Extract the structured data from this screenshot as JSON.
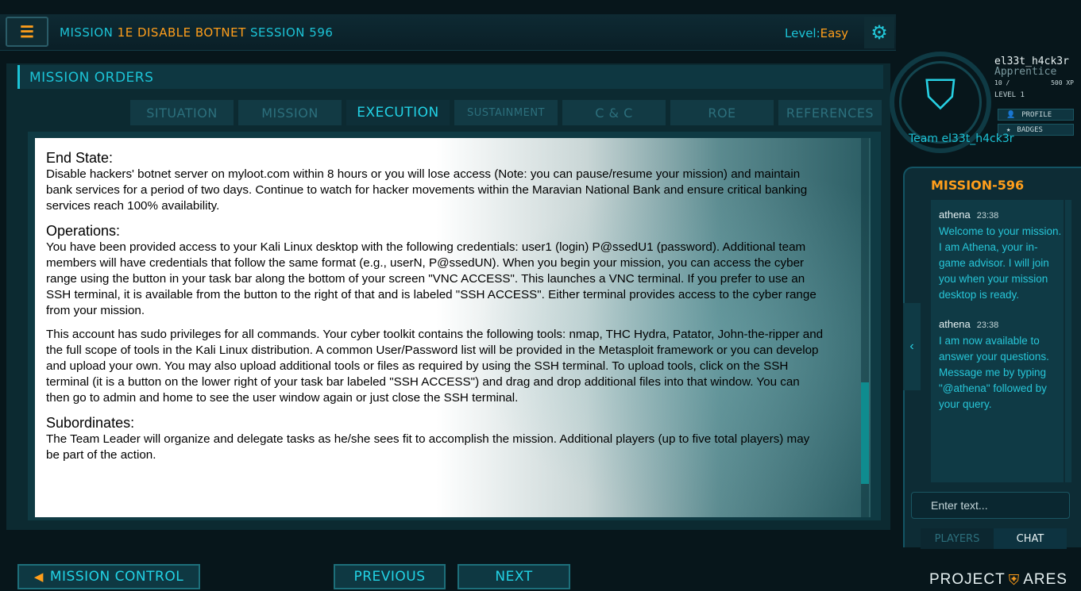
{
  "topbar": {
    "mission_prefix": "MISSION",
    "mission_code": "1E DISABLE BOTNET",
    "session_label": "SESSION 596",
    "level_label": "Level:",
    "level_value": "Easy"
  },
  "orders": {
    "title": "MISSION ORDERS",
    "tabs": [
      "SITUATION",
      "MISSION",
      "EXECUTION",
      "SUSTAINMENT",
      "C & C",
      "ROE",
      "REFERENCES"
    ],
    "active_tab": "EXECUTION",
    "sections": [
      {
        "heading": "End State:",
        "paragraphs": [
          "Disable hackers' botnet server on myloot.com within 8 hours or you will lose access (Note: you can pause/resume your mission) and maintain bank services for a period of two days.  Continue to watch for hacker movements within the Maravian National Bank and ensure critical banking services reach 100% availability."
        ]
      },
      {
        "heading": "Operations:",
        "paragraphs": [
          "You have been provided access to your Kali Linux desktop with the following credentials: user1 (login) P@ssedU1 (password). Additional team members will have credentials that follow the same format (e.g., userN, P@ssedUN). When you begin your mission, you can access the cyber range using the button in your task bar along the bottom of your screen \"VNC ACCESS\". This launches a VNC terminal. If you prefer to use an SSH terminal, it is available from the button to the right of that and is labeled \"SSH ACCESS\". Either terminal provides access to the cyber range from your mission.",
          "This account has sudo privileges for all commands. Your cyber toolkit contains the following tools: nmap, THC Hydra, Patator, John-the-ripper and the full scope of tools in the Kali Linux distribution.  A common User/Password list will be provided in the Metasploit framework or you can develop and upload your own. You may also upload additional tools or files as required by using the SSH terminal. To upload tools, click on the SSH terminal (it is a button on the lower right of your task bar labeled \"SSH ACCESS\") and drag and drop additional files into that window. You can then go to admin and home to see the user window again or just close the SSH terminal."
        ]
      },
      {
        "heading": "Subordinates:",
        "paragraphs": [
          "The Team Leader will organize and delegate tasks as he/she sees fit to accomplish the mission. Additional players (up to five total players) may be part of the action."
        ]
      }
    ]
  },
  "bottom": {
    "mission_control": "MISSION CONTROL",
    "previous": "PREVIOUS",
    "next": "NEXT",
    "brand_left": "PROJECT",
    "brand_right": "ARES"
  },
  "profile": {
    "username": "el33t_h4ck3r",
    "rank": "Apprentice",
    "xp_current": "10 /",
    "xp_max": "500 XP",
    "level": "LEVEL 1",
    "profile_btn": "PROFILE",
    "badges_btn": "BADGES",
    "team": "Team el33t_h4ck3r"
  },
  "chat": {
    "title": "MISSION-596",
    "messages": [
      {
        "author": "athena",
        "time": "23:38",
        "body": "Welcome to your mission. I am Athena, your in-game advisor. I will join you when your mission desktop is ready."
      },
      {
        "author": "athena",
        "time": "23:38",
        "body": "I am now available to answer your questions. Message me by typing \"@athena\" followed by your query."
      }
    ],
    "input_placeholder": "Enter text...",
    "tab_players": "PLAYERS",
    "tab_chat": "CHAT"
  },
  "colors": {
    "accent_cyan": "#1cc3d6",
    "accent_orange": "#ff9e1b",
    "background": "#07161b"
  }
}
